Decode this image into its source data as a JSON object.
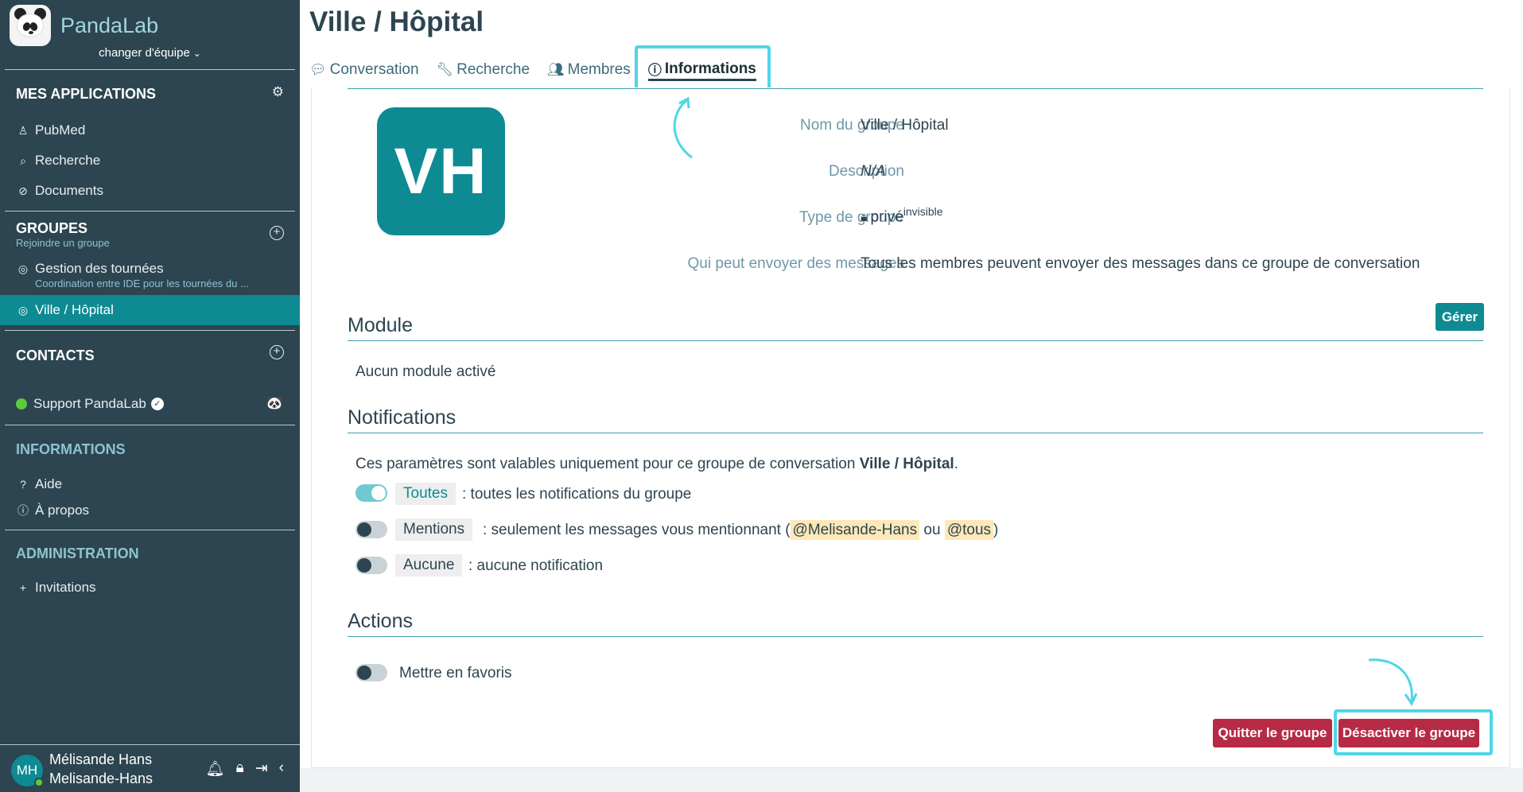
{
  "sidebar": {
    "brand": "PandaLab",
    "team_switch": "changer d'équipe",
    "apps": {
      "title": "MES APPLICATIONS",
      "items": [
        {
          "label": "PubMed",
          "icon": "user-icon"
        },
        {
          "label": "Recherche",
          "icon": "search-icon"
        },
        {
          "label": "Documents",
          "icon": "paperclip-icon"
        }
      ]
    },
    "groups": {
      "title": "GROUPES",
      "subtitle": "Rejoindre un groupe",
      "items": [
        {
          "label": "Gestion des tournées",
          "sub": "Coordination entre IDE pour les tournées du ..."
        },
        {
          "label": "Ville / Hôpital",
          "active": true
        }
      ]
    },
    "contacts": {
      "title": "CONTACTS",
      "items": [
        {
          "label": "Support PandaLab",
          "online": true,
          "verified": true
        }
      ]
    },
    "informations": {
      "title": "INFORMATIONS",
      "items": [
        {
          "label": "Aide",
          "icon": "question-icon"
        },
        {
          "label": "À propos",
          "icon": "info-icon"
        }
      ]
    },
    "administration": {
      "title": "ADMINISTRATION",
      "items": [
        {
          "label": "Invitations",
          "icon": "plus-icon"
        }
      ]
    },
    "user": {
      "initials": "MH",
      "name": "Mélisande Hans",
      "handle": "Melisande-Hans"
    }
  },
  "main": {
    "title": "Ville / Hôpital",
    "tabs": [
      {
        "label": "Conversation",
        "icon": "chat-icon"
      },
      {
        "label": "Recherche",
        "icon": "wrench-icon"
      },
      {
        "label": "Membres",
        "icon": "members-icon"
      },
      {
        "label": "Informations",
        "icon": "info-icon",
        "active": true
      }
    ],
    "group_avatar": "VH",
    "info": {
      "name_label": "Nom du groupe",
      "name_value": "Ville / Hôpital",
      "desc_label": "Description",
      "desc_value": "N/A",
      "type_label": "Type de groupe",
      "type_value": "privé",
      "type_sup": "invisible",
      "who_label": "Qui peut envoyer des messages",
      "who_value": "Tous les membres peuvent envoyer des messages dans ce groupe de conversation"
    },
    "module": {
      "title": "Module",
      "manage_button": "Gérer",
      "empty": "Aucun module activé"
    },
    "notifications": {
      "title": "Notifications",
      "intro_prefix": "Ces paramètres sont valables uniquement pour ce groupe de conversation",
      "intro_group": "Ville / Hôpital",
      "intro_suffix": ".",
      "options": [
        {
          "chip": "Toutes",
          "desc": ": toutes les notifications du groupe",
          "on": true
        },
        {
          "chip": "Mentions",
          "desc_prefix": ": seulement les messages vous mentionnant (",
          "mention1": "@Melisande-Hans",
          "or": "ou",
          "mention2": "@tous",
          "desc_suffix": ")",
          "on": false
        },
        {
          "chip": "Aucune",
          "desc": ": aucune notification",
          "on": false
        }
      ]
    },
    "actions": {
      "title": "Actions",
      "favorite": "Mettre en favoris",
      "quit_button": "Quitter le groupe",
      "disable_button": "Désactiver le groupe"
    }
  },
  "colors": {
    "sidebar_bg": "#2d4550",
    "accent": "#0e8a93",
    "danger": "#b72a45",
    "highlight": "#4fd6e6"
  }
}
